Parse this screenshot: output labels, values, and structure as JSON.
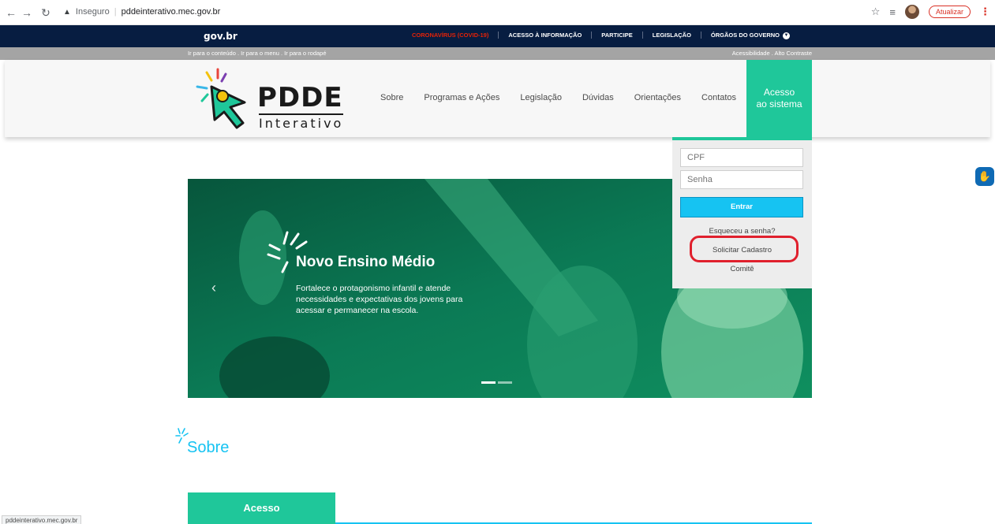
{
  "browser": {
    "security_label": "Inseguro",
    "url": "pddeinterativo.mec.gov.br",
    "update_label": "Atualizar",
    "status_url": "pddeinterativo.mec.gov.br"
  },
  "gov_bar": {
    "logo": "gov.br",
    "links": [
      "CORONAVÍRUS (COVID-19)",
      "ACESSO À INFORMAÇÃO",
      "PARTICIPE",
      "LEGISLAÇÃO",
      "ÓRGÃOS DO GOVERNO"
    ]
  },
  "access_strip": {
    "left": "Ir para o conteúdo . Ir para o menu . Ir para o rodapé",
    "right": "Acessibilidade . Alto Contraste"
  },
  "header": {
    "logo_title": "PDDE",
    "logo_sub": "Interativo",
    "nav": [
      "Sobre",
      "Programas e Ações",
      "Legislação",
      "Dúvidas",
      "Orientações",
      "Contatos"
    ],
    "system_button": [
      "Acesso",
      "ao sistema"
    ]
  },
  "login": {
    "cpf_placeholder": "CPF",
    "password_placeholder": "Senha",
    "enter_label": "Entrar",
    "forgot_label": "Esqueceu a senha?",
    "register_label": "Solicitar Cadastro",
    "committee_label": "Comitê"
  },
  "hero": {
    "title": "Novo Ensino Médio",
    "text": "Fortalece o protagonismo infantil e atende necessidades e expectativas dos jovens para acessar e permanecer na escola."
  },
  "sobre": {
    "title": "Sobre"
  },
  "acesso": {
    "tab_label": "Acesso"
  },
  "colors": {
    "gov_blue": "#071d41",
    "accent_green": "#1fc79a",
    "accent_cyan": "#16c3f2",
    "covid_red": "#e52207",
    "highlight_red": "#e0202d"
  }
}
